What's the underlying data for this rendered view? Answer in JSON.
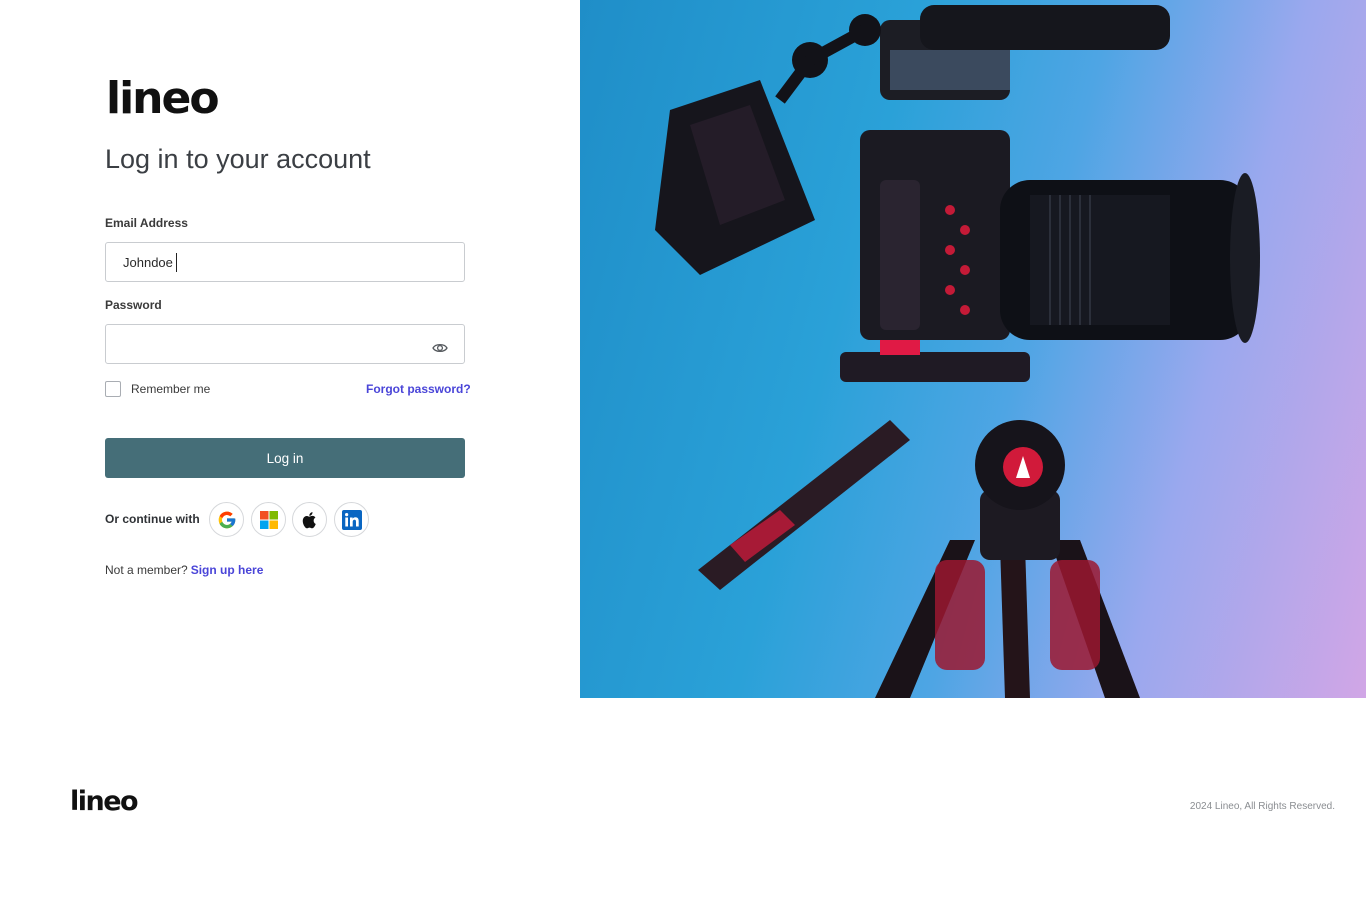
{
  "brand": {
    "logo_text": "lineo"
  },
  "login": {
    "heading": "Log in to your account",
    "email_label": "Email Address",
    "email_value": "Johndoe",
    "password_label": "Password",
    "password_value": "",
    "remember_label": "Remember me",
    "remember_checked": false,
    "forgot_label": "Forgot password?",
    "submit_label": "Log in",
    "continue_label": "Or continue with",
    "social": [
      "google-icon",
      "microsoft-icon",
      "apple-icon",
      "linkedin-icon"
    ],
    "member_prompt": "Not a member?",
    "signup_label": "Sign up here"
  },
  "footer": {
    "logo_text": "lineo",
    "copyright": "2024 Lineo, All Rights Reserved."
  },
  "colors": {
    "button": "#456e78",
    "link": "#4a45d8",
    "heading": "#3b3f44"
  }
}
